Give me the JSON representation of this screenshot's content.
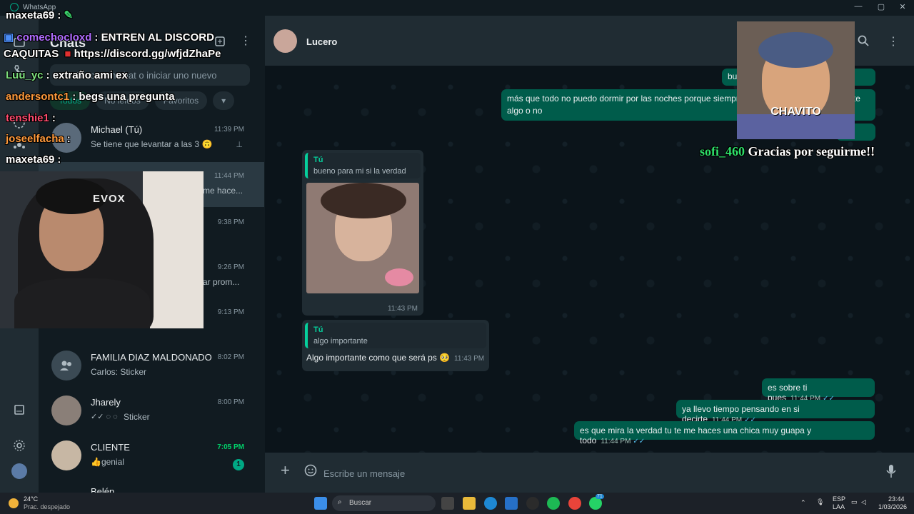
{
  "titlebar": {
    "app_name": "WhatsApp"
  },
  "sidebar": {
    "title": "Chats",
    "search_placeholder": "Buscar un chat o iniciar uno nuevo",
    "filters": [
      "Todos",
      "No leídos",
      "Favoritos"
    ]
  },
  "chats": [
    {
      "name": "Michael (Tú)",
      "time": "11:39 PM",
      "preview": "Se tiene que levantar a las 3 🙃"
    },
    {
      "name": "",
      "time": "11:44 PM",
      "preview": "me hace..."
    },
    {
      "name": "",
      "time": "9:38 PM",
      "preview": ""
    },
    {
      "name": "",
      "time": "9:26 PM",
      "preview": "ar prom..."
    },
    {
      "name": "",
      "time": "9:13 PM",
      "preview": ""
    },
    {
      "name": "FAMILIA DIAZ MALDONADO",
      "time": "8:02 PM",
      "preview": "Carlos: Sticker"
    },
    {
      "name": "Jharely",
      "time": "8:00 PM",
      "preview": "Sticker"
    },
    {
      "name": "CLIENTE",
      "time": "7:05 PM",
      "preview": "👍genial",
      "badge": "1"
    },
    {
      "name": "Belén",
      "time": "",
      "preview": ""
    }
  ],
  "conversation": {
    "contact": "Lucero",
    "messages": {
      "m1_fragment": "bu",
      "m2": "más que todo no puedo dormir por las noches porque siempre",
      "m2_end": "te",
      "m2_line2": "algo o no",
      "reply1_who": "Tú",
      "reply1_quote": "bueno para mi si la verdad",
      "reply1_time": "11:43 PM",
      "reply2_who": "Tú",
      "reply2_quote": "algo importante",
      "reply2_text": "Algo importante como que será ps 🥺",
      "reply2_time": "11:43 PM",
      "o1": "es sobre ti pues",
      "o1_time": "11:44 PM",
      "o2": "ya llevo tiempo pensando en si decirte",
      "o2_time": "11:44 PM",
      "o3": "es que mira la verdad tu te me haces una chica muy guapa y todo",
      "o3_time": "11:44 PM"
    },
    "composer_placeholder": "Escribe un mensaje"
  },
  "stream": {
    "chat": [
      {
        "user": "maxeta69",
        "text": ""
      },
      {
        "user": "comechocIoxd",
        "text": "ENTREN AL DISCORD"
      },
      {
        "user": "CAQUITAS",
        "text": "https://discord.gg/wfjdZhaPe"
      },
      {
        "user": "Luu_yc",
        "text": "extraño ami ex"
      },
      {
        "user": "andersontc1",
        "text": "begs una pregunta"
      },
      {
        "user": "tenshie1",
        "text": ""
      },
      {
        "user": "joseelfacha",
        "text": ""
      },
      {
        "user": "maxeta69",
        "text": ""
      }
    ],
    "cam_label": "EVOX",
    "cam2_label": "CHAVITO",
    "follow_user": "sofi_460",
    "follow_text": "Gracias por seguirme!!",
    "colors": {
      "comechoco": "#b06cff",
      "luu": "#7ee07e",
      "anderson": "#ff9a3c",
      "tenshie": "#ff4b6e",
      "joseel": "#ff9a3c",
      "maxeta": "#ffffff",
      "follow": "#2ee06a"
    }
  },
  "taskbar": {
    "weather_temp": "24°C",
    "weather_desc": "Prac. despejado",
    "search": "Buscar",
    "lang1": "ESP",
    "lang2": "LAA",
    "time": "23:44",
    "date": "1/03/2026",
    "wa_badge": "71"
  }
}
